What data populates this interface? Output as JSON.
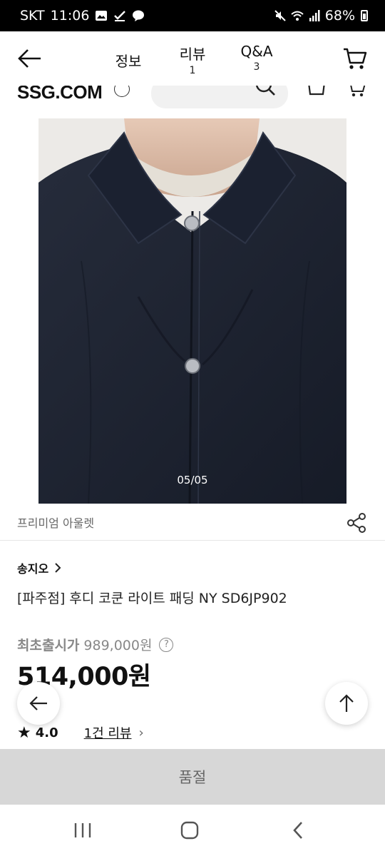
{
  "status_bar": {
    "carrier": "SKT",
    "time": "11:06",
    "battery": "68%"
  },
  "header": {
    "tabs": [
      {
        "label": "정보",
        "count": ""
      },
      {
        "label": "리뷰",
        "count": "1"
      },
      {
        "label": "Q&A",
        "count": "3"
      }
    ]
  },
  "ssg": {
    "logo": "SSG.COM"
  },
  "image": {
    "counter": "05/05"
  },
  "brand": {
    "label": "프리미엄 아울렛"
  },
  "product": {
    "seller": "송지오",
    "name": "[파주점] 후디 코쿤 라이트 패딩 NY SD6JP902",
    "original_price_label": "최초출시가",
    "original_price": "989,000원",
    "price": "514,000원",
    "rating": "4.0",
    "review_link": "1건 리뷰"
  },
  "cta": {
    "label": "품절"
  },
  "colors": {
    "image_bg": "#1d2331",
    "soldout_bg": "#d7d7d7"
  }
}
